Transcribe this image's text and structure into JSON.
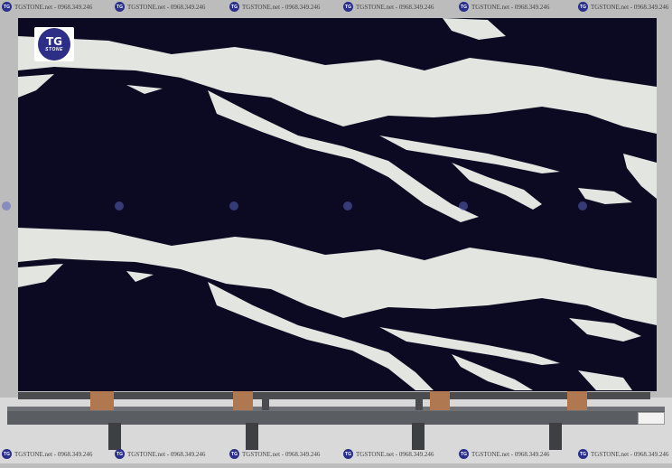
{
  "watermark": {
    "text": "TGSTONE.net - 0968.349.246",
    "logo_mark": "TG"
  },
  "logo": {
    "mark": "TG",
    "word": "STONE"
  },
  "colors": {
    "slab": "#0b0a22",
    "vein": "#e3e5e0",
    "rack": "#5a5d62",
    "wood": "#b07850",
    "floor": "#d8d8d8",
    "wall": "#bdbdbd",
    "brand": "#2d2e86"
  }
}
